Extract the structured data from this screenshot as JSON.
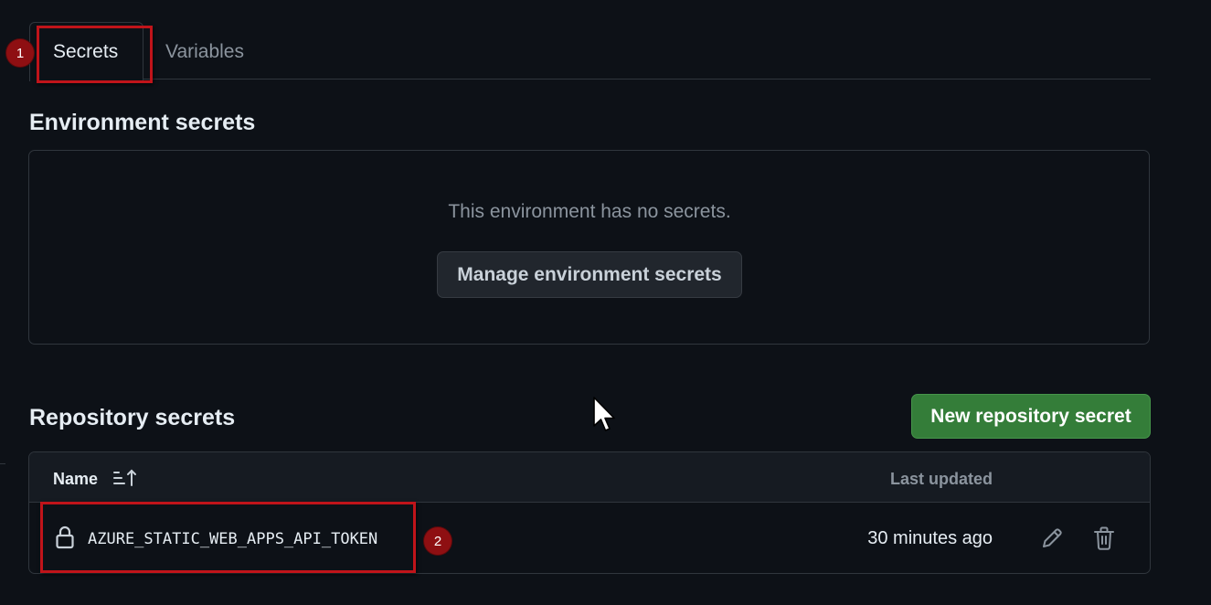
{
  "tabs": {
    "secrets_label": "Secrets",
    "variables_label": "Variables"
  },
  "annotations": {
    "badge_1": "1",
    "badge_2": "2"
  },
  "environment": {
    "heading": "Environment secrets",
    "empty_message": "This environment has no secrets.",
    "manage_button_label": "Manage environment secrets"
  },
  "repository": {
    "heading": "Repository secrets",
    "new_button_label": "New repository secret",
    "table": {
      "col_name": "Name",
      "col_last_updated": "Last updated",
      "rows": [
        {
          "name": "AZURE_STATIC_WEB_APPS_API_TOKEN",
          "last_updated": "30 minutes ago",
          "icons": [
            "lock-icon",
            "pencil-icon",
            "trash-icon"
          ]
        }
      ]
    }
  },
  "colors": {
    "background": "#0d1117",
    "border": "#30363d",
    "primary_button": "#347d39",
    "annotation_red": "#c0141a"
  }
}
